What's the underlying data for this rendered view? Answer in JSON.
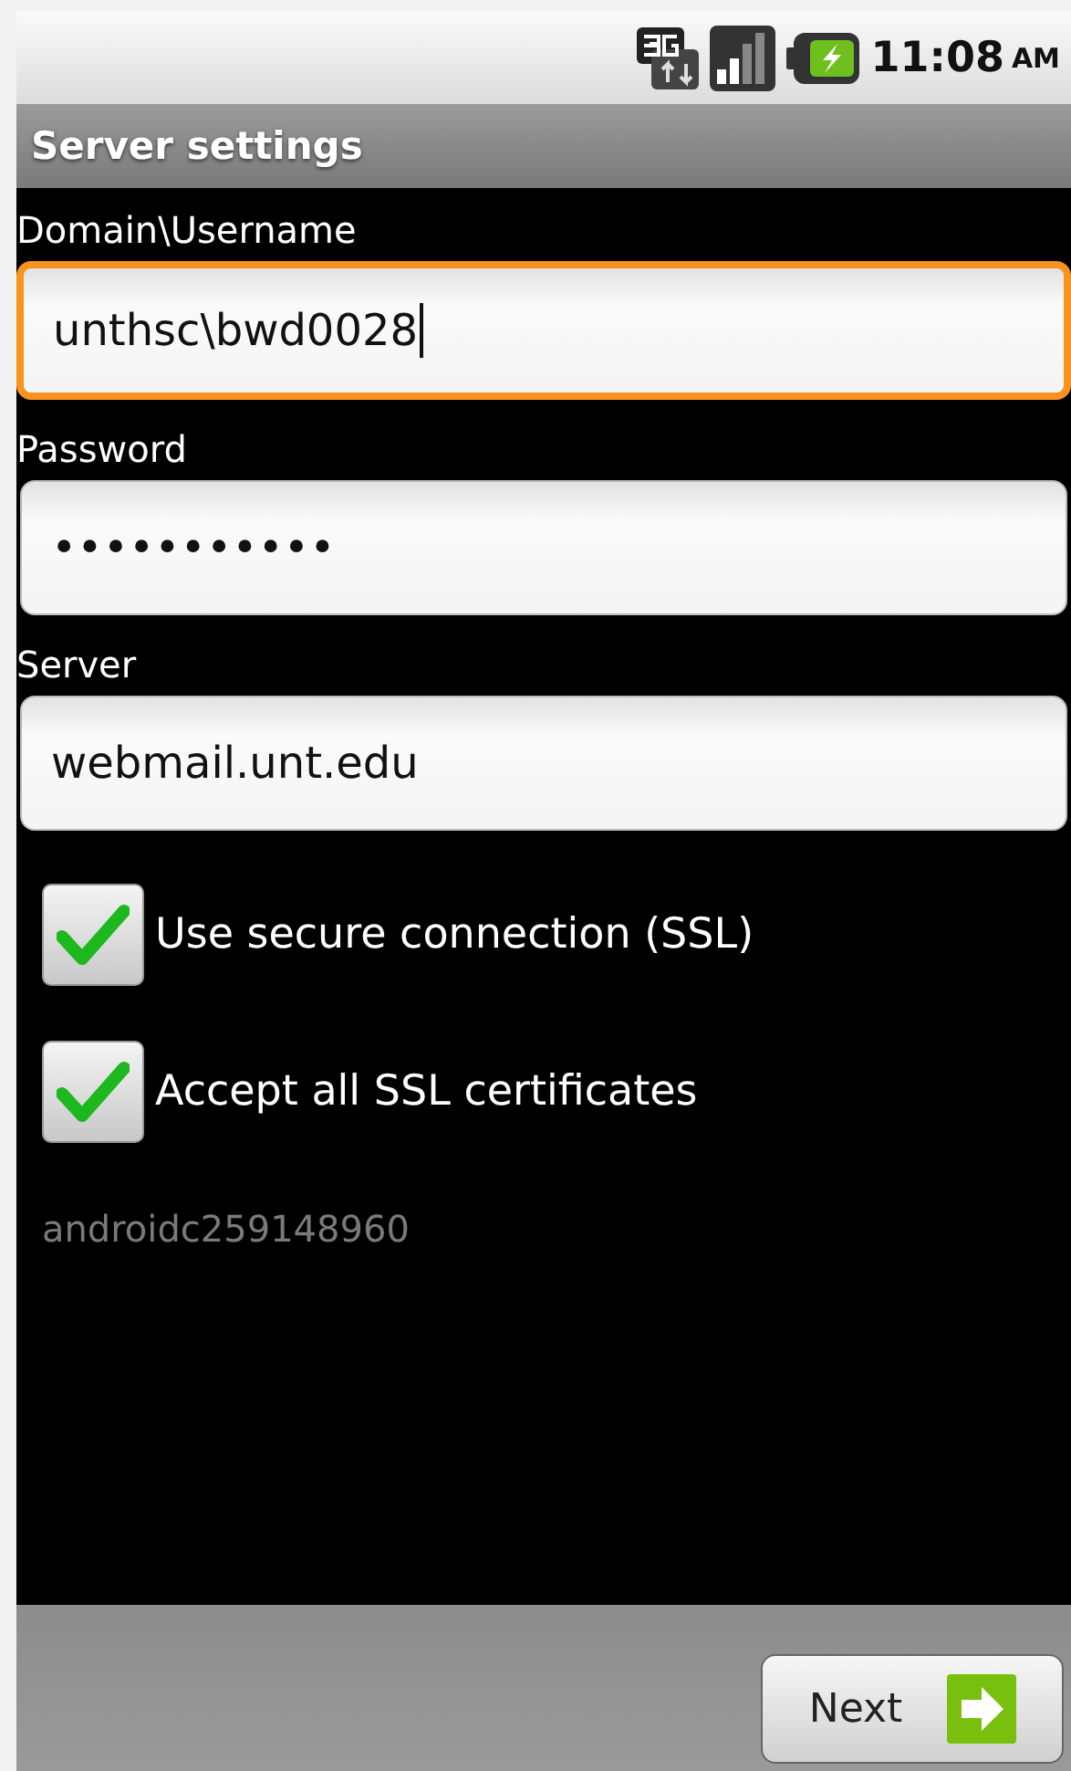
{
  "status_bar": {
    "time": "11:08",
    "meridiem": "AM"
  },
  "title": "Server settings",
  "fields": [
    {
      "label": "Domain\\Username",
      "value": "unthsc\\bwd0028",
      "focused": true
    },
    {
      "label": "Password",
      "value": "•••••••••••",
      "focused": false
    },
    {
      "label": "Server",
      "value": "webmail.unt.edu",
      "focused": false
    }
  ],
  "checkboxes": [
    {
      "label": "Use secure connection (SSL)",
      "checked": true
    },
    {
      "label": "Accept all SSL certificates",
      "checked": true
    }
  ],
  "account_id": "androidc259148960",
  "next_button": "Next"
}
